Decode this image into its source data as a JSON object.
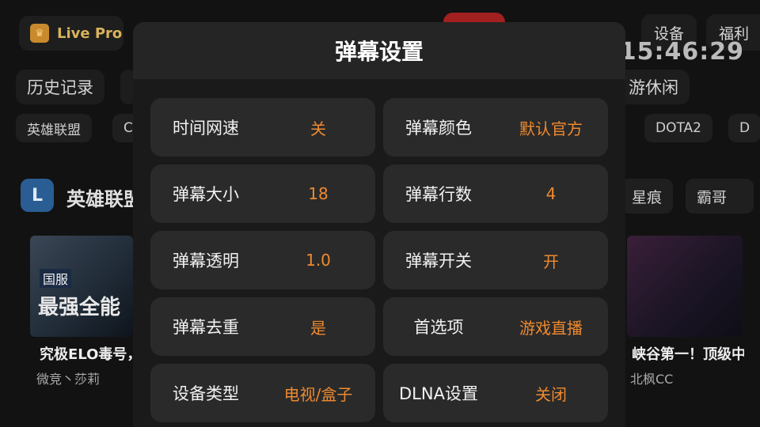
{
  "brand": {
    "logo_icon": "crown-icon",
    "name": "Live Pro"
  },
  "top_nav": {
    "device": "设备",
    "welfare": "福利",
    "clock": "15:46:29"
  },
  "categories_row": {
    "history": "历史记录",
    "casual": "游休闲"
  },
  "game_chips": {
    "lol": "英雄联盟",
    "c_partial": "C",
    "dota2": "DOTA2",
    "d_partial": "D"
  },
  "section": {
    "icon_letter": "L",
    "title": "英雄联盟",
    "tags": [
      "星痕",
      "霸哥"
    ]
  },
  "cards": [
    {
      "thumb_text": "国服",
      "thumb_text2": "最强全能",
      "title": "究极ELO毒号，",
      "streamer": "微竞丶莎莉"
    },
    {
      "title": "峡谷第一！顶级中",
      "streamer": "北枫CC"
    }
  ],
  "dialog": {
    "title": "弹幕设置",
    "options": [
      {
        "label": "时间网速",
        "value": "关"
      },
      {
        "label": "弹幕颜色",
        "value": "默认官方"
      },
      {
        "label": "弹幕大小",
        "value": "18"
      },
      {
        "label": "弹幕行数",
        "value": "4"
      },
      {
        "label": "弹幕透明",
        "value": "1.0"
      },
      {
        "label": "弹幕开关",
        "value": "开"
      },
      {
        "label": "弹幕去重",
        "value": "是"
      },
      {
        "label": "首选项",
        "value": "游戏直播"
      },
      {
        "label": "设备类型",
        "value": "电视/盒子"
      },
      {
        "label": "DLNA设置",
        "value": "关闭"
      }
    ]
  },
  "colors": {
    "accent": "#ef8a2e",
    "brand": "#d8b35a",
    "background": "#121212"
  }
}
